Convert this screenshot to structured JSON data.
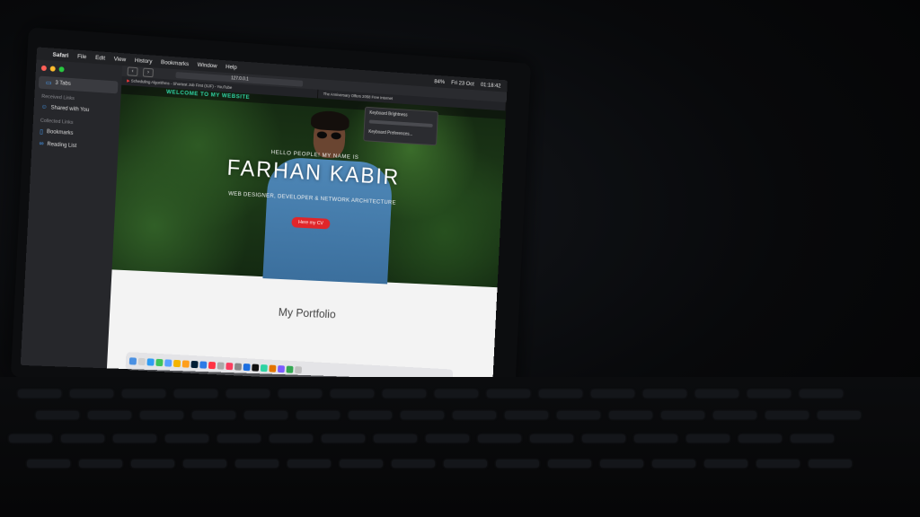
{
  "menubar": {
    "apple_icon": "apple-icon",
    "app_name": "Safari",
    "items": [
      "File",
      "Edit",
      "View",
      "History",
      "Bookmarks",
      "Window",
      "Help"
    ],
    "battery": "84%",
    "datetime": "Fri 23 Oct",
    "time": "01:18:42"
  },
  "sidebar": {
    "tabs_label": "3 Tabs",
    "received_heading": "Received Links",
    "shared_label": "Shared with You",
    "collected_heading": "Collected Links",
    "bookmarks_label": "Bookmarks",
    "reading_list_label": "Reading List"
  },
  "toolbar": {
    "url": "127.0.0.1"
  },
  "tabs": [
    {
      "label": "Scheduling Algorithms - Shortest Job First (SJF) - YouTube"
    },
    {
      "label": "The Anniversary Offers 2058 Free Internet"
    }
  ],
  "brightness_menu": {
    "title": "Keyboard Brightness",
    "prefs": "Keyboard Preferences..."
  },
  "site": {
    "brand": "WELCOME TO MY WEBSITE",
    "hello": "HELLO PEOPLE! MY NAME IS",
    "name": "FARHAN KABIR",
    "tagline": "WEB DESIGNER, DEVELOPER & NETWORK ARCHITECTURE",
    "cv_button": "Here my CV",
    "portfolio_title": "My Portfolio"
  },
  "colors": {
    "brand_teal": "#2fd3a3",
    "cv_red": "#e0262a"
  }
}
